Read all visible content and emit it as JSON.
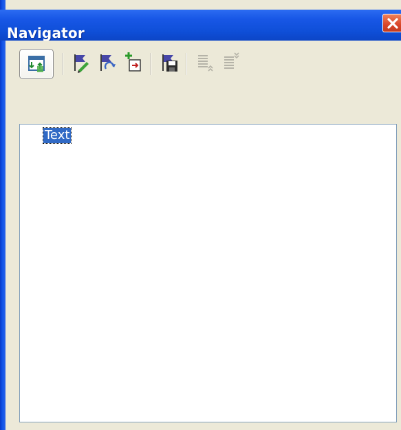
{
  "window": {
    "title": "Navigator"
  },
  "toolbar": {
    "buttons": [
      {
        "name": "toggle-icon",
        "state": "pressed"
      },
      {
        "name": "set-reminder-icon"
      },
      {
        "name": "navigation-reminder-icon"
      },
      {
        "name": "insert-icon"
      },
      {
        "name": "save-icon"
      },
      {
        "name": "promote-level-icon",
        "state": "disabled"
      },
      {
        "name": "demote-level-icon",
        "state": "disabled"
      }
    ]
  },
  "tree": {
    "items": [
      {
        "label": "Text",
        "selected": true
      }
    ]
  },
  "colors": {
    "titlebar": "#0f4fd8",
    "selection": "#316ac5",
    "face": "#ece9d8",
    "close": "#d9462a"
  }
}
